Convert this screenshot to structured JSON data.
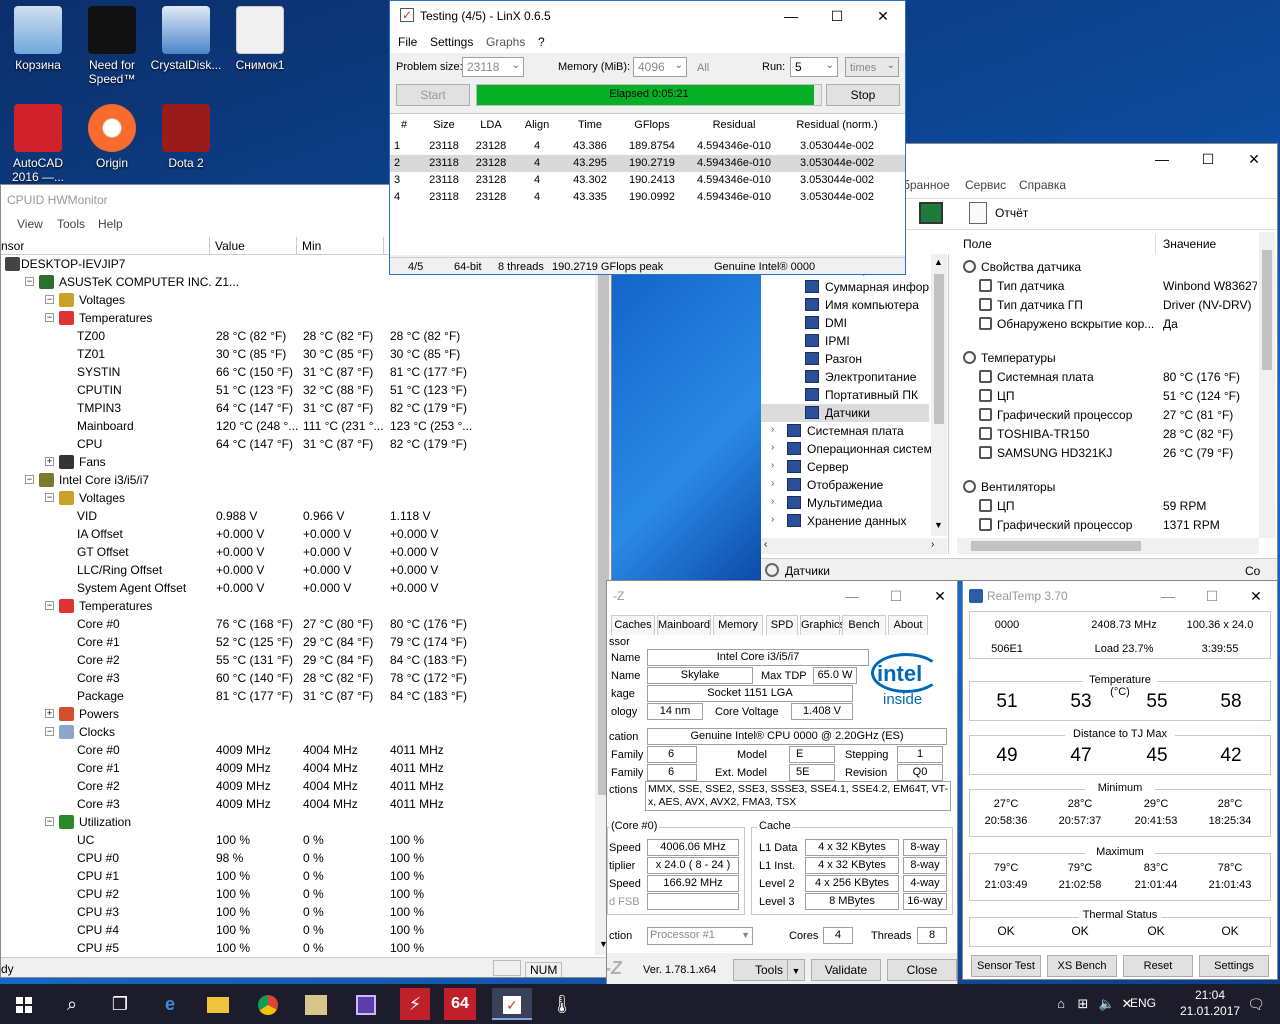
{
  "desktop": {
    "icons": [
      {
        "label": "Корзина",
        "icon": "recycle-bin-icon",
        "color": "#6fa8dc"
      },
      {
        "label": "Need for Speed™",
        "icon": "need-for-speed-icon",
        "color": "#111111"
      },
      {
        "label": "CrystalDisk...",
        "icon": "crystaldisk-icon",
        "color": "#4a86c8"
      },
      {
        "label": "Снимок1",
        "icon": "image-file-icon",
        "color": "#e8e8e8"
      },
      {
        "label": "AutoCAD 2016 —...",
        "icon": "autocad-icon",
        "color": "#d1222b"
      },
      {
        "label": "Origin",
        "icon": "origin-icon",
        "color": "#f56c2d"
      },
      {
        "label": "Dota 2",
        "icon": "dota2-icon",
        "color": "#9a1b1b"
      }
    ]
  },
  "linx": {
    "title": "Testing (4/5) - LinX 0.6.5",
    "menu": [
      "File",
      "Settings",
      "Graphs",
      "?"
    ],
    "problem_size_label": "Problem size:",
    "problem_size": "23118",
    "memory_label": "Memory (MiB):",
    "memory": "4096",
    "all_label": "All",
    "run_label": "Run:",
    "run": "5",
    "times": "times",
    "start_label": "Start",
    "stop_label": "Stop",
    "elapsed": "Elapsed 0:05:21",
    "progress": 0.98,
    "columns": [
      "#",
      "Size",
      "LDA",
      "Align",
      "Time",
      "GFlops",
      "Residual",
      "Residual (norm.)"
    ],
    "rows": [
      [
        "1",
        "23118",
        "23128",
        "4",
        "43.386",
        "189.8754",
        "4.594346e-010",
        "3.053044e-002"
      ],
      [
        "2",
        "23118",
        "23128",
        "4",
        "43.295",
        "190.2719",
        "4.594346e-010",
        "3.053044e-002"
      ],
      [
        "3",
        "23118",
        "23128",
        "4",
        "43.302",
        "190.2413",
        "4.594346e-010",
        "3.053044e-002"
      ],
      [
        "4",
        "23118",
        "23128",
        "4",
        "43.335",
        "190.0992",
        "4.594346e-010",
        "3.053044e-002"
      ]
    ],
    "status": [
      "4/5",
      "64-bit",
      "8 threads",
      "190.2719 GFlops peak",
      "Genuine Intel® 0000"
    ]
  },
  "hwmon": {
    "title": "CPUID HWMonitor",
    "menu": [
      "View",
      "Tools",
      "Help"
    ],
    "col_sensor": "nsor",
    "col_value": "Value",
    "col_min": "Min",
    "status_left": "dy",
    "status_num": "NUM",
    "rows": [
      {
        "indent": 0,
        "label": "DESKTOP-IEVJIP7",
        "v": "",
        "mn": "",
        "mx": "",
        "icon": "computer-icon"
      },
      {
        "indent": 1,
        "label": "ASUSTeK COMPUTER INC. Z1...",
        "v": "",
        "mn": "",
        "mx": "",
        "icon": "motherboard-icon"
      },
      {
        "indent": 2,
        "label": "Voltages",
        "v": "",
        "mn": "",
        "mx": "",
        "icon": "voltage-icon"
      },
      {
        "indent": 2,
        "label": "Temperatures",
        "v": "",
        "mn": "",
        "mx": "",
        "icon": "thermometer-icon"
      },
      {
        "indent": 3,
        "label": "TZ00",
        "v": "28 °C  (82 °F)",
        "mn": "28 °C  (82 °F)",
        "mx": "28 °C  (82 °F)"
      },
      {
        "indent": 3,
        "label": "TZ01",
        "v": "30 °C  (85 °F)",
        "mn": "30 °C  (85 °F)",
        "mx": "30 °C  (85 °F)"
      },
      {
        "indent": 3,
        "label": "SYSTIN",
        "v": "66 °C  (150 °F)",
        "mn": "31 °C  (87 °F)",
        "mx": "81 °C  (177 °F)"
      },
      {
        "indent": 3,
        "label": "CPUTIN",
        "v": "51 °C  (123 °F)",
        "mn": "32 °C  (88 °F)",
        "mx": "51 °C  (123 °F)"
      },
      {
        "indent": 3,
        "label": "TMPIN3",
        "v": "64 °C  (147 °F)",
        "mn": "31 °C  (87 °F)",
        "mx": "82 °C  (179 °F)"
      },
      {
        "indent": 3,
        "label": "Mainboard",
        "v": "120 °C  (248 °...",
        "mn": "111 °C  (231 °...",
        "mx": "123 °C  (253 °..."
      },
      {
        "indent": 3,
        "label": "CPU",
        "v": "64 °C  (147 °F)",
        "mn": "31 °C  (87 °F)",
        "mx": "82 °C  (179 °F)"
      },
      {
        "indent": 2,
        "label": "Fans",
        "v": "",
        "mn": "",
        "mx": "",
        "icon": "fan-icon"
      },
      {
        "indent": 1,
        "label": "Intel Core i3/i5/i7",
        "v": "",
        "mn": "",
        "mx": "",
        "icon": "cpu-chip-icon"
      },
      {
        "indent": 2,
        "label": "Voltages",
        "v": "",
        "mn": "",
        "mx": "",
        "icon": "voltage-icon"
      },
      {
        "indent": 3,
        "label": "VID",
        "v": "0.988 V",
        "mn": "0.966 V",
        "mx": "1.118 V"
      },
      {
        "indent": 3,
        "label": "IA Offset",
        "v": "+0.000 V",
        "mn": "+0.000 V",
        "mx": "+0.000 V"
      },
      {
        "indent": 3,
        "label": "GT Offset",
        "v": "+0.000 V",
        "mn": "+0.000 V",
        "mx": "+0.000 V"
      },
      {
        "indent": 3,
        "label": "LLC/Ring Offset",
        "v": "+0.000 V",
        "mn": "+0.000 V",
        "mx": "+0.000 V"
      },
      {
        "indent": 3,
        "label": "System Agent Offset",
        "v": "+0.000 V",
        "mn": "+0.000 V",
        "mx": "+0.000 V"
      },
      {
        "indent": 2,
        "label": "Temperatures",
        "v": "",
        "mn": "",
        "mx": "",
        "icon": "thermometer-icon"
      },
      {
        "indent": 3,
        "label": "Core #0",
        "v": "76 °C  (168 °F)",
        "mn": "27 °C  (80 °F)",
        "mx": "80 °C  (176 °F)"
      },
      {
        "indent": 3,
        "label": "Core #1",
        "v": "52 °C  (125 °F)",
        "mn": "29 °C  (84 °F)",
        "mx": "79 °C  (174 °F)"
      },
      {
        "indent": 3,
        "label": "Core #2",
        "v": "55 °C  (131 °F)",
        "mn": "29 °C  (84 °F)",
        "mx": "84 °C  (183 °F)"
      },
      {
        "indent": 3,
        "label": "Core #3",
        "v": "60 °C  (140 °F)",
        "mn": "28 °C  (82 °F)",
        "mx": "78 °C  (172 °F)"
      },
      {
        "indent": 3,
        "label": "Package",
        "v": "81 °C  (177 °F)",
        "mn": "31 °C  (87 °F)",
        "mx": "84 °C  (183 °F)"
      },
      {
        "indent": 2,
        "label": "Powers",
        "v": "",
        "mn": "",
        "mx": "",
        "icon": "power-icon"
      },
      {
        "indent": 2,
        "label": "Clocks",
        "v": "",
        "mn": "",
        "mx": "",
        "icon": "clock-icon"
      },
      {
        "indent": 3,
        "label": "Core #0",
        "v": "4009 MHz",
        "mn": "4004 MHz",
        "mx": "4011 MHz"
      },
      {
        "indent": 3,
        "label": "Core #1",
        "v": "4009 MHz",
        "mn": "4004 MHz",
        "mx": "4011 MHz"
      },
      {
        "indent": 3,
        "label": "Core #2",
        "v": "4009 MHz",
        "mn": "4004 MHz",
        "mx": "4011 MHz"
      },
      {
        "indent": 3,
        "label": "Core #3",
        "v": "4009 MHz",
        "mn": "4004 MHz",
        "mx": "4011 MHz"
      },
      {
        "indent": 2,
        "label": "Utilization",
        "v": "",
        "mn": "",
        "mx": "",
        "icon": "utilization-icon"
      },
      {
        "indent": 3,
        "label": "UC",
        "v": "100 %",
        "mn": "0 %",
        "mx": "100 %"
      },
      {
        "indent": 3,
        "label": "CPU #0",
        "v": "98 %",
        "mn": "0 %",
        "mx": "100 %"
      },
      {
        "indent": 3,
        "label": "CPU #1",
        "v": "100 %",
        "mn": "0 %",
        "mx": "100 %"
      },
      {
        "indent": 3,
        "label": "CPU #2",
        "v": "100 %",
        "mn": "0 %",
        "mx": "100 %"
      },
      {
        "indent": 3,
        "label": "CPU #3",
        "v": "100 %",
        "mn": "0 %",
        "mx": "100 %"
      },
      {
        "indent": 3,
        "label": "CPU #4",
        "v": "100 %",
        "mn": "0 %",
        "mx": "100 %"
      },
      {
        "indent": 3,
        "label": "CPU #5",
        "v": "100 %",
        "mn": "0 %",
        "mx": "100 %"
      }
    ]
  },
  "aida": {
    "menu": [
      "бранное",
      "Сервис",
      "Справка"
    ],
    "report_label": "Отчёт",
    "col_field": "Поле",
    "col_value": "Значение",
    "tree": [
      {
        "indent": 0,
        "label": "Компьютер"
      },
      {
        "indent": 1,
        "label": "Суммарная инфор"
      },
      {
        "indent": 1,
        "label": "Имя компьютера"
      },
      {
        "indent": 1,
        "label": "DMI"
      },
      {
        "indent": 1,
        "label": "IPMI"
      },
      {
        "indent": 1,
        "label": "Разгон"
      },
      {
        "indent": 1,
        "label": "Электропитание"
      },
      {
        "indent": 1,
        "label": "Портативный ПК"
      },
      {
        "indent": 1,
        "label": "Датчики"
      },
      {
        "indent": 0,
        "label": "Системная плата"
      },
      {
        "indent": 0,
        "label": "Операционная систем"
      },
      {
        "indent": 0,
        "label": "Сервер"
      },
      {
        "indent": 0,
        "label": "Отображение"
      },
      {
        "indent": 0,
        "label": "Мультимедиа"
      },
      {
        "indent": 0,
        "label": "Хранение данных"
      }
    ],
    "list": [
      {
        "group": true,
        "field": "Свойства датчика",
        "value": ""
      },
      {
        "group": false,
        "field": "Тип датчика",
        "value": "Winbond W83627"
      },
      {
        "group": false,
        "field": "Тип датчика ГП",
        "value": "Driver  (NV-DRV)"
      },
      {
        "group": false,
        "field": "Обнаружено вскрытие кор...",
        "value": "Да"
      },
      {
        "group": true,
        "field": "Температуры",
        "value": ""
      },
      {
        "group": false,
        "field": "Системная плата",
        "value": "80 °C  (176 °F)"
      },
      {
        "group": false,
        "field": "ЦП",
        "value": "51 °C  (124 °F)"
      },
      {
        "group": false,
        "field": "Графический процессор",
        "value": "27 °C  (81 °F)"
      },
      {
        "group": false,
        "field": "TOSHIBA-TR150",
        "value": "28 °C  (82 °F)"
      },
      {
        "group": false,
        "field": "SAMSUNG HD321KJ",
        "value": "26 °C  (79 °F)"
      },
      {
        "group": true,
        "field": "Вентиляторы",
        "value": ""
      },
      {
        "group": false,
        "field": "ЦП",
        "value": "59 RPM"
      },
      {
        "group": false,
        "field": "Графический процессор",
        "value": "1371 RPM"
      }
    ],
    "status": "Датчики",
    "status_right": "Co"
  },
  "cpuz": {
    "title": "-Z",
    "tabs": [
      "Caches",
      "Mainboard",
      "Memory",
      "SPD",
      "Graphics",
      "Bench",
      "About"
    ],
    "sec_processor": "ssor",
    "name_label": "Name",
    "name": "Intel Core i3/i5/i7",
    "codename_label": "Name",
    "codename": "Skylake",
    "maxtdp_label": "Max TDP",
    "maxtdp": "65.0 W",
    "package_label": "kage",
    "package": "Socket 1151 LGA",
    "tech_label": "ology",
    "tech": "14 nm",
    "corevolt_label": "Core Voltage",
    "corevolt": "1.408 V",
    "spec_label": "cation",
    "spec": "Genuine Intel® CPU 0000 @ 2.20GHz (ES)",
    "family_label": "Family",
    "family": "6",
    "model_label": "Model",
    "model": "E",
    "stepping_label": "Stepping",
    "stepping": "1",
    "extfamily_label": "Family",
    "extfamily": "6",
    "extmodel_label": "Ext. Model",
    "extmodel": "5E",
    "revision_label": "Revision",
    "revision": "Q0",
    "instr_label": "ctions",
    "instr": "MMX, SSE, SSE2, SSE3, SSSE3, SSE4.1, SSE4.2, EM64T, VT-x, AES, AVX, AVX2, FMA3, TSX",
    "clocks_title": "(Core #0)",
    "speed_label": "Speed",
    "speed": "4006.06 MHz",
    "mult_label": "tiplier",
    "mult": "x 24.0 ( 8 - 24 )",
    "bus_label": "Speed",
    "bus": "166.92 MHz",
    "fsb_label": "d FSB",
    "cache_title": "Cache",
    "caches": [
      {
        "label": "L1 Data",
        "size": "4 x 32 KBytes",
        "way": "8-way"
      },
      {
        "label": "L1 Inst.",
        "size": "4 x 32 KBytes",
        "way": "8-way"
      },
      {
        "label": "Level 2",
        "size": "4 x 256 KBytes",
        "way": "4-way"
      },
      {
        "label": "Level 3",
        "size": "8 MBytes",
        "way": "16-way"
      }
    ],
    "selection_label": "ction",
    "selection": "Processor #1",
    "cores_label": "Cores",
    "cores": "4",
    "threads_label": "Threads",
    "threads": "8",
    "brand": "-Z",
    "version": "Ver. 1.78.1.x64",
    "tools_label": "Tools",
    "validate_label": "Validate",
    "close_label": "Close",
    "logo_text": "intel",
    "logo_sub": "inside"
  },
  "realtemp": {
    "title": "RealTemp 3.70",
    "top": [
      "0000",
      "2408.73 MHz",
      "100.36 x 24.0",
      "506E1",
      "Load  23.7%",
      "3:39:55"
    ],
    "temp_title": "Temperature (°C)",
    "temps": [
      "51",
      "53",
      "55",
      "58"
    ],
    "dist_title": "Distance to TJ Max",
    "dists": [
      "49",
      "47",
      "45",
      "42"
    ],
    "min_title": "Minimum",
    "mins": [
      "27°C",
      "28°C",
      "29°C",
      "28°C"
    ],
    "min_times": [
      "20:58:36",
      "20:57:37",
      "20:41:53",
      "18:25:34"
    ],
    "max_title": "Maximum",
    "maxs": [
      "79°C",
      "79°C",
      "83°C",
      "78°C"
    ],
    "max_times": [
      "21:03:49",
      "21:02:58",
      "21:01:44",
      "21:01:43"
    ],
    "status_title": "Thermal Status",
    "statuses": [
      "OK",
      "OK",
      "OK",
      "OK"
    ],
    "buttons": [
      "Sensor Test",
      "XS Bench",
      "Reset",
      "Settings"
    ]
  },
  "taskbar": {
    "lang": "ENG",
    "time": "21:04",
    "date": "21.01.2017"
  }
}
